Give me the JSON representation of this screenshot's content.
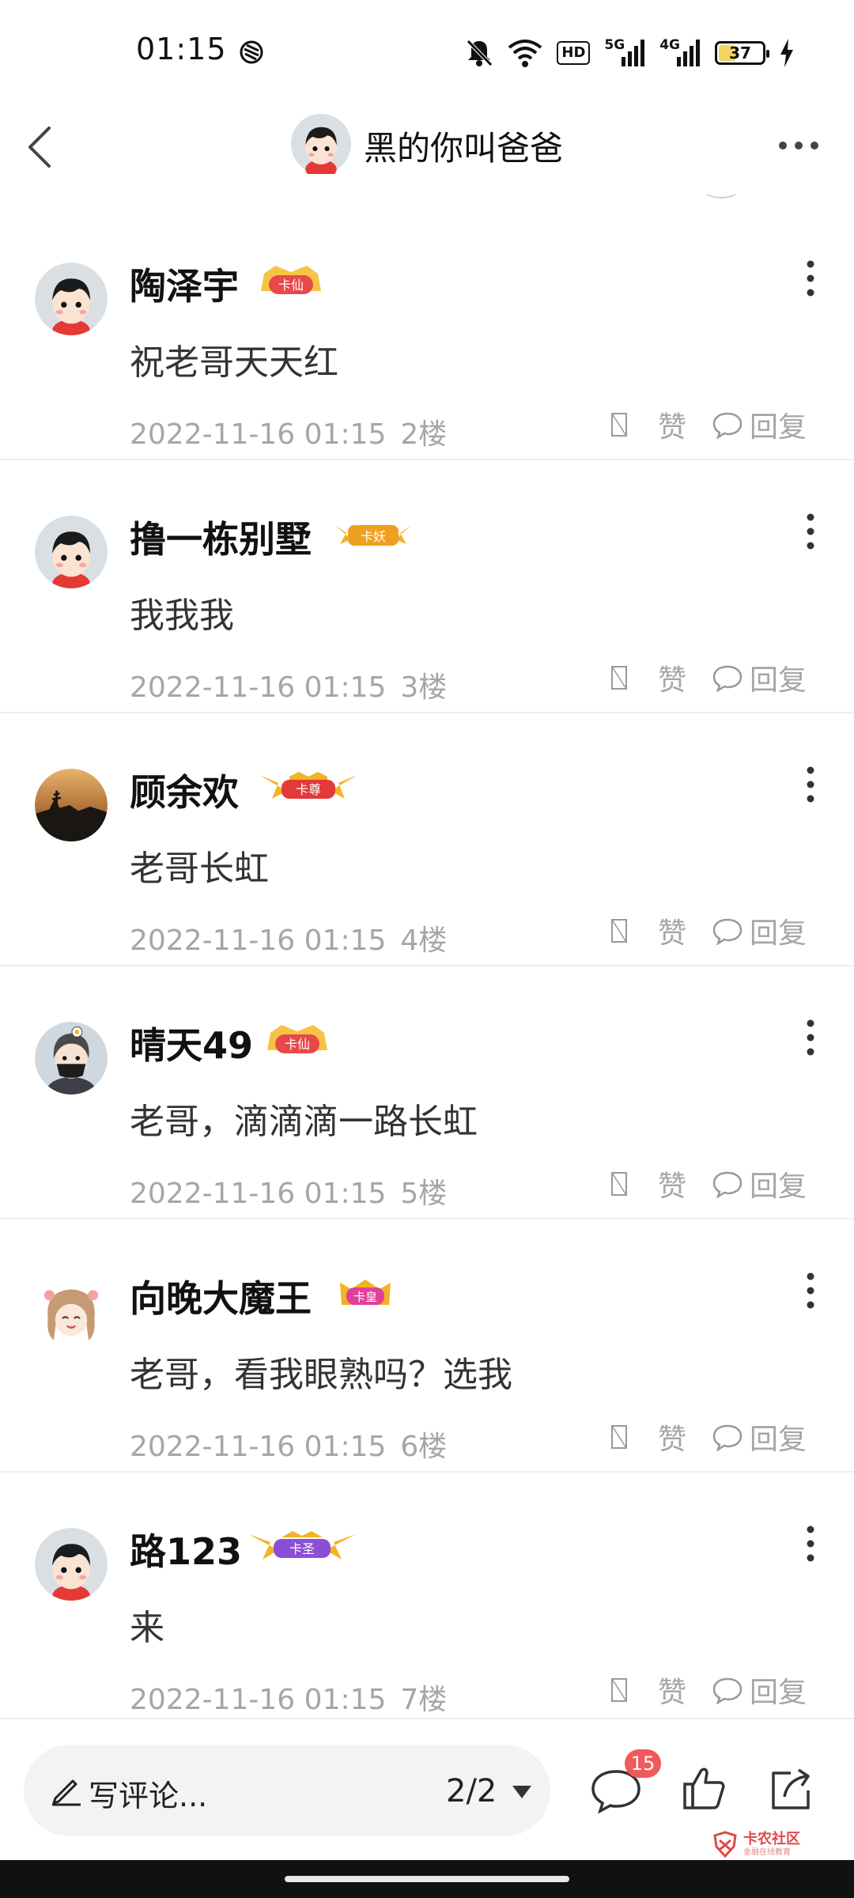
{
  "status_bar": {
    "time": "01:15",
    "battery": "37",
    "hd_label": "HD",
    "net1": "5G",
    "net2": "4G",
    "icons": [
      "mute-icon",
      "wifi-icon",
      "signal-5g-icon",
      "signal-4g-icon",
      "battery-icon",
      "charging-icon"
    ]
  },
  "header": {
    "title": "黑的你叫爸爸",
    "back_icon": "chevron-left-icon",
    "more_icon": "more-horizontal-icon"
  },
  "comments": [
    {
      "name": "陶泽宇",
      "badge": "卡仙",
      "badge_color": "#e8484a",
      "text": "祝老哥天天红",
      "date": "2022-11-16 01:15",
      "floor": "2楼",
      "like": "赞",
      "reply": "回复",
      "avatar": "cartoon-boy"
    },
    {
      "name": "撸一栋别墅",
      "badge": "卡妖",
      "badge_color": "#f0a020",
      "text": "我我我",
      "date": "2022-11-16 01:15",
      "floor": "3楼",
      "like": "赞",
      "reply": "回复",
      "avatar": "cartoon-boy"
    },
    {
      "name": "顾余欢",
      "badge": "卡尊",
      "badge_color": "#e23a3a",
      "text": "老哥长虹",
      "date": "2022-11-16 01:15",
      "floor": "4楼",
      "like": "赞",
      "reply": "回复",
      "avatar": "sunset-photo"
    },
    {
      "name": "晴天49",
      "badge": "卡仙",
      "badge_color": "#e8484a",
      "text": "老哥，滴滴滴一路长虹",
      "date": "2022-11-16 01:15",
      "floor": "5楼",
      "like": "赞",
      "reply": "回复",
      "avatar": "masked-boy"
    },
    {
      "name": "向晚大魔王",
      "badge": "卡皇",
      "badge_color": "#e0409a",
      "text": "老哥，看我眼熟吗？选我",
      "date": "2022-11-16 01:15",
      "floor": "6楼",
      "like": "赞",
      "reply": "回复",
      "avatar": "anime-girl"
    },
    {
      "name": "路123",
      "badge": "卡圣",
      "badge_color": "#8a4fd6",
      "text": "来",
      "date": "2022-11-16 01:15",
      "floor": "7楼",
      "like": "赞",
      "reply": "回复",
      "avatar": "cartoon-boy"
    }
  ],
  "bottom_bar": {
    "input_placeholder": "写评论...",
    "pager": "2/2",
    "comment_count": "15",
    "icons": [
      "pencil-icon",
      "caret-down-icon",
      "comment-icon",
      "thumbs-up-icon",
      "share-icon"
    ]
  },
  "watermark": {
    "main": "卡农社区",
    "sub": "金融在线教育"
  }
}
